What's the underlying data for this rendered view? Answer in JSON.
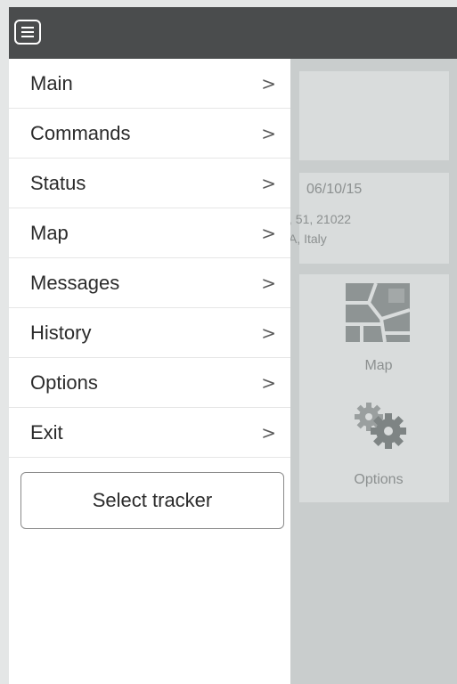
{
  "header": {
    "menu_icon": "hamburger-menu-icon"
  },
  "drawer": {
    "items": [
      {
        "label": "Main",
        "chevron": ">"
      },
      {
        "label": "Commands",
        "chevron": ">"
      },
      {
        "label": "Status",
        "chevron": ">"
      },
      {
        "label": "Map",
        "chevron": ">"
      },
      {
        "label": "Messages",
        "chevron": ">"
      },
      {
        "label": "History",
        "chevron": ">"
      },
      {
        "label": "Options",
        "chevron": ">"
      },
      {
        "label": "Exit",
        "chevron": ">"
      }
    ],
    "select_tracker_label": "Select tracker"
  },
  "background": {
    "date": "06/10/15",
    "address_line1": ", 51, 21022",
    "address_line2": "A, Italy",
    "map_label": "Map",
    "options_label": "Options"
  },
  "colors": {
    "topbar": "#4a4c4d",
    "overlay": "#c9cdcd",
    "drawer": "#ffffff"
  }
}
